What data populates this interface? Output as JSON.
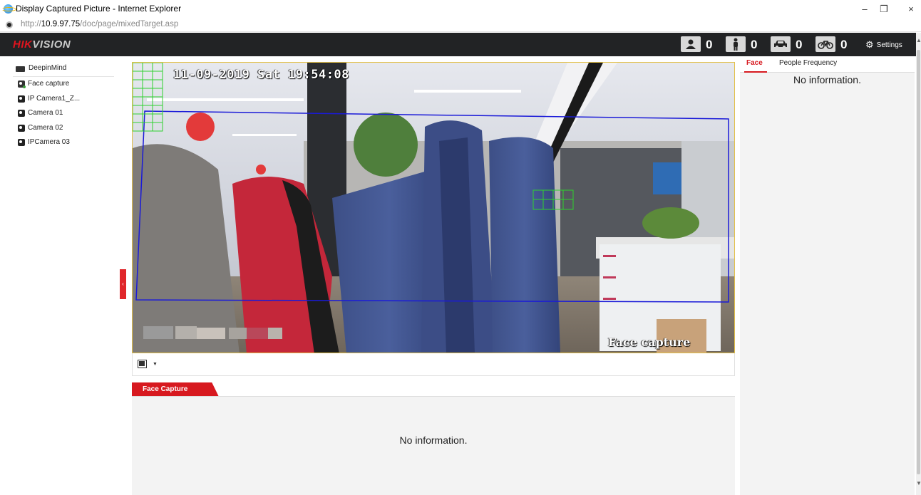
{
  "window": {
    "title": "Display Captured Picture - Internet Explorer",
    "controls": {
      "minimize": "–",
      "restore": "❐",
      "close": "×"
    }
  },
  "address": {
    "prefix": "http://",
    "host": "10.9.97.75",
    "path": "/doc/page/mixedTarget.asp"
  },
  "header": {
    "logo_red": "HIK",
    "logo_gray": "VISION",
    "counters": [
      {
        "icon": "face-count-icon",
        "value": "0"
      },
      {
        "icon": "person-count-icon",
        "value": "0"
      },
      {
        "icon": "vehicle-count-icon",
        "value": "0"
      },
      {
        "icon": "bike-count-icon",
        "value": "0"
      }
    ],
    "settings_label": "Settings"
  },
  "tree": {
    "root": "DeepinMind",
    "items": [
      "Face capture",
      "IP Camera1_Z...",
      "Camera 01",
      "Camera 02",
      "IPCamera 03"
    ]
  },
  "video": {
    "osd_time": "11-09-2019 Sat 19:54:08",
    "osd_name": "Face capture"
  },
  "face_capture": {
    "tab_label": "Face Capture",
    "empty_text": "No information."
  },
  "right_panel": {
    "tabs": [
      "Face",
      "People Frequency"
    ],
    "active_tab": "Face",
    "empty_text": "No information."
  },
  "colors": {
    "accent": "#d7191f",
    "header_bg": "#222325",
    "panel_bg": "#f3f3f3",
    "video_border": "#e2c04a"
  }
}
